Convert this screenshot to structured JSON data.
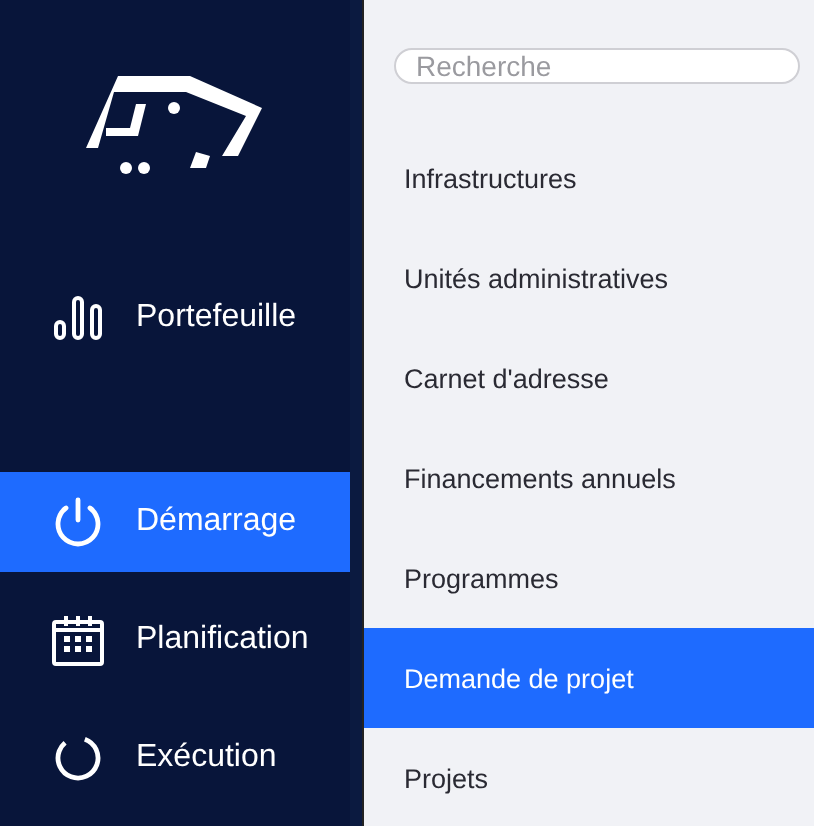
{
  "nav": [
    {
      "label": "Portefeuille",
      "selected": false
    },
    {
      "label": "Démarrage",
      "selected": true
    },
    {
      "label": "Planification",
      "selected": false
    },
    {
      "label": "Exécution",
      "selected": false
    }
  ],
  "search": {
    "placeholder": "Recherche"
  },
  "menu": [
    {
      "label": "Infrastructures",
      "selected": false
    },
    {
      "label": "Unités administratives",
      "selected": false
    },
    {
      "label": "Carnet d'adresse",
      "selected": false
    },
    {
      "label": "Financements annuels",
      "selected": false
    },
    {
      "label": "Programmes",
      "selected": false
    },
    {
      "label": "Demande de projet",
      "selected": true
    },
    {
      "label": "Projets",
      "selected": false
    }
  ]
}
